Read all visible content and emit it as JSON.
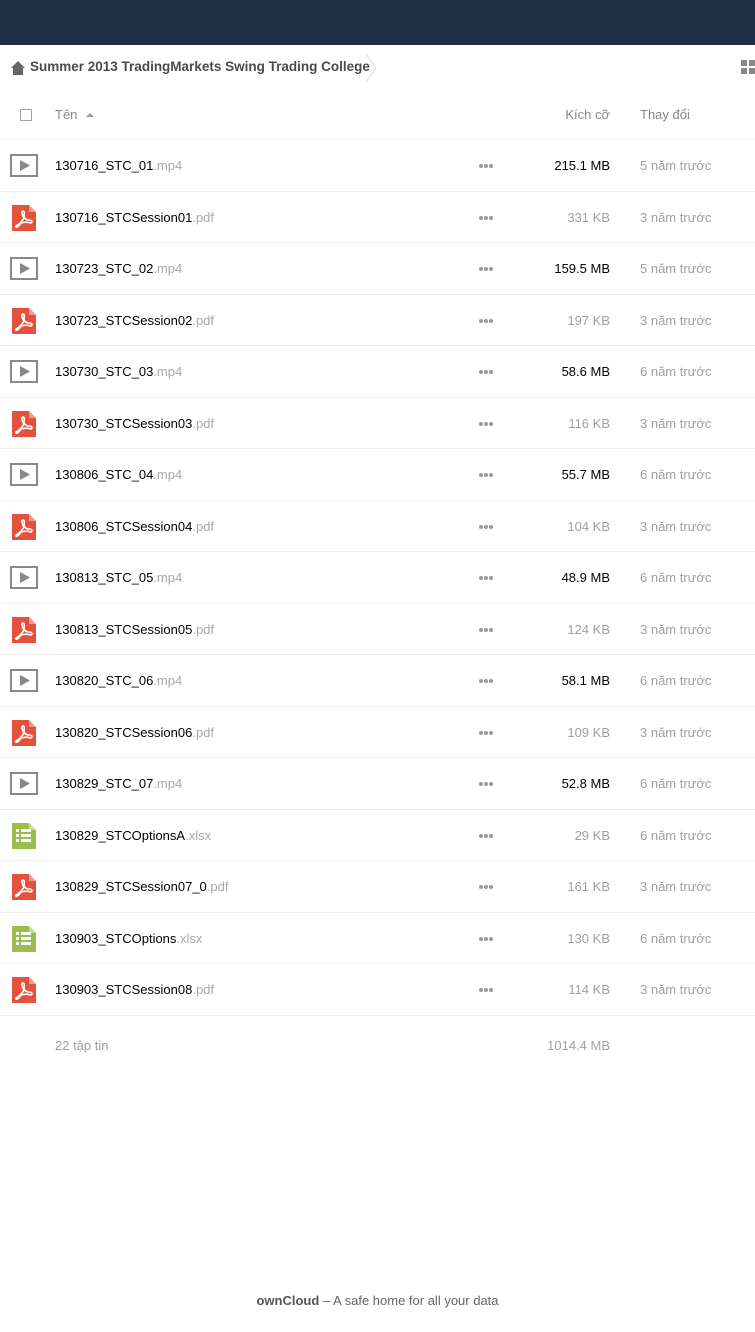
{
  "colors": {
    "header_bg": "#1d2d44",
    "pdf_red": "#e2523d",
    "sheet_green": "#9abd4e",
    "video_gray": "#888888"
  },
  "breadcrumb": {
    "home_icon": "home-icon",
    "current": "Summer 2013 TradingMarkets Swing Trading College"
  },
  "table": {
    "col_name": "Tên",
    "col_size": "Kích cỡ",
    "col_modified": "Thay đổi"
  },
  "files": [
    {
      "base": "130716_STC_01",
      "ext": ".mp4",
      "size": "215.1 MB",
      "modified": "5 năm trước",
      "type": "video"
    },
    {
      "base": "130716_STCSession01",
      "ext": ".pdf",
      "size": "331 KB",
      "modified": "3 năm trước",
      "type": "pdf"
    },
    {
      "base": "130723_STC_02",
      "ext": ".mp4",
      "size": "159.5 MB",
      "modified": "5 năm trước",
      "type": "video"
    },
    {
      "base": "130723_STCSession02",
      "ext": ".pdf",
      "size": "197 KB",
      "modified": "3 năm trước",
      "type": "pdf"
    },
    {
      "base": "130730_STC_03",
      "ext": ".mp4",
      "size": "58.6 MB",
      "modified": "6 năm trước",
      "type": "video"
    },
    {
      "base": "130730_STCSession03",
      "ext": ".pdf",
      "size": "116 KB",
      "modified": "3 năm trước",
      "type": "pdf"
    },
    {
      "base": "130806_STC_04",
      "ext": ".mp4",
      "size": "55.7 MB",
      "modified": "6 năm trước",
      "type": "video"
    },
    {
      "base": "130806_STCSession04",
      "ext": ".pdf",
      "size": "104 KB",
      "modified": "3 năm trước",
      "type": "pdf"
    },
    {
      "base": "130813_STC_05",
      "ext": ".mp4",
      "size": "48.9 MB",
      "modified": "6 năm trước",
      "type": "video"
    },
    {
      "base": "130813_STCSession05",
      "ext": ".pdf",
      "size": "124 KB",
      "modified": "3 năm trước",
      "type": "pdf"
    },
    {
      "base": "130820_STC_06",
      "ext": ".mp4",
      "size": "58.1 MB",
      "modified": "6 năm trước",
      "type": "video"
    },
    {
      "base": "130820_STCSession06",
      "ext": ".pdf",
      "size": "109 KB",
      "modified": "3 năm trước",
      "type": "pdf"
    },
    {
      "base": "130829_STC_07",
      "ext": ".mp4",
      "size": "52.8 MB",
      "modified": "6 năm trước",
      "type": "video"
    },
    {
      "base": "130829_STCOptionsA",
      "ext": ".xlsx",
      "size": "29 KB",
      "modified": "6 năm trước",
      "type": "sheet"
    },
    {
      "base": "130829_STCSession07_0",
      "ext": ".pdf",
      "size": "161 KB",
      "modified": "3 năm trước",
      "type": "pdf"
    },
    {
      "base": "130903_STCOptions",
      "ext": ".xlsx",
      "size": "130 KB",
      "modified": "6 năm trước",
      "type": "sheet"
    },
    {
      "base": "130903_STCSession08",
      "ext": ".pdf",
      "size": "114 KB",
      "modified": "3 năm trước",
      "type": "pdf"
    }
  ],
  "summary": {
    "count": "22 tập tin",
    "total_size": "1014.4 MB"
  },
  "footer": {
    "brand": "ownCloud",
    "tagline": " – A safe home for all your data"
  }
}
